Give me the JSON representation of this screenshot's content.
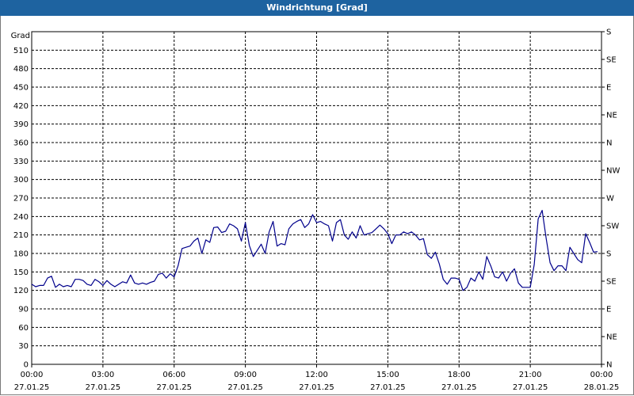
{
  "window": {
    "title": "Windrichtung [Grad]"
  },
  "colors": {
    "titlebar": "#1e63a0",
    "line": "#00008b",
    "grid": "#000000"
  },
  "chart_data": {
    "type": "line",
    "title": "Windrichtung [Grad]",
    "ylabel": "Grad",
    "ylim": [
      0,
      540
    ],
    "yticks": [
      0,
      30,
      60,
      90,
      120,
      150,
      180,
      210,
      240,
      270,
      300,
      330,
      360,
      390,
      420,
      450,
      480,
      510
    ],
    "right_axis_labels": [
      "N",
      "NE",
      "E",
      "SE",
      "S",
      "SW",
      "W",
      "NW",
      "N",
      "NE",
      "E",
      "SE",
      "S"
    ],
    "xlim": [
      "27.01.25 00:00",
      "28.01.25 00:00"
    ],
    "xticks": [
      {
        "time": "00:00",
        "date": "27.01.25"
      },
      {
        "time": "03:00",
        "date": "27.01.25"
      },
      {
        "time": "06:00",
        "date": "27.01.25"
      },
      {
        "time": "09:00",
        "date": "27.01.25"
      },
      {
        "time": "12:00",
        "date": "27.01.25"
      },
      {
        "time": "15:00",
        "date": "27.01.25"
      },
      {
        "time": "18:00",
        "date": "27.01.25"
      },
      {
        "time": "21:00",
        "date": "27.01.25"
      },
      {
        "time": "00:00",
        "date": "28.01.25"
      }
    ],
    "grid": true,
    "series": [
      {
        "x": [
          "00:00",
          "00:10",
          "00:20",
          "00:30",
          "00:40",
          "00:50",
          "01:00",
          "01:10",
          "01:20",
          "01:30",
          "01:40",
          "01:50",
          "02:00",
          "02:10",
          "02:20",
          "02:30",
          "02:40",
          "02:50",
          "03:00",
          "03:10",
          "03:20",
          "03:30",
          "03:40",
          "03:50",
          "04:00",
          "04:10",
          "04:20",
          "04:30",
          "04:40",
          "04:50",
          "05:00",
          "05:10",
          "05:20",
          "05:30",
          "05:40",
          "05:50",
          "06:00",
          "06:10",
          "06:20",
          "06:30",
          "06:40",
          "06:50",
          "07:00",
          "07:10",
          "07:20",
          "07:30",
          "07:40",
          "07:50",
          "08:00",
          "08:10",
          "08:20",
          "08:30",
          "08:40",
          "08:50",
          "09:00",
          "09:10",
          "09:20",
          "09:30",
          "09:40",
          "09:50",
          "10:00",
          "10:10",
          "10:20",
          "10:30",
          "10:40",
          "10:50",
          "11:00",
          "11:10",
          "11:20",
          "11:30",
          "11:40",
          "11:50",
          "12:00",
          "12:10",
          "12:20",
          "12:30",
          "12:40",
          "12:50",
          "13:00",
          "13:10",
          "13:20",
          "13:30",
          "13:40",
          "13:50",
          "14:00",
          "14:10",
          "14:20",
          "14:30",
          "14:40",
          "14:50",
          "15:00",
          "15:10",
          "15:20",
          "15:30",
          "15:40",
          "15:50",
          "16:00",
          "16:10",
          "16:20",
          "16:30",
          "16:40",
          "16:50",
          "17:00",
          "17:10",
          "17:20",
          "17:30",
          "17:40",
          "17:50",
          "18:00",
          "18:10",
          "18:20",
          "18:30",
          "18:40",
          "18:50",
          "19:00",
          "19:10",
          "19:20",
          "19:30",
          "19:40",
          "19:50",
          "20:00",
          "20:10",
          "20:20",
          "20:30",
          "20:40",
          "20:50",
          "21:00",
          "21:10",
          "21:20",
          "21:30",
          "21:40",
          "21:50",
          "22:00",
          "22:10",
          "22:20",
          "22:30",
          "22:40",
          "22:50",
          "23:00",
          "23:10",
          "23:20",
          "23:30",
          "23:40",
          "23:50"
        ],
        "values": [
          130,
          126,
          128,
          128,
          140,
          143,
          125,
          130,
          126,
          128,
          126,
          138,
          138,
          136,
          130,
          128,
          138,
          134,
          128,
          136,
          130,
          126,
          130,
          134,
          132,
          145,
          132,
          130,
          132,
          130,
          133,
          135,
          146,
          148,
          140,
          147,
          142,
          160,
          188,
          190,
          192,
          200,
          205,
          180,
          202,
          198,
          222,
          223,
          214,
          216,
          228,
          225,
          220,
          200,
          230,
          193,
          175,
          185,
          195,
          180,
          215,
          232,
          192,
          196,
          194,
          220,
          228,
          232,
          235,
          222,
          228,
          243,
          230,
          232,
          228,
          225,
          200,
          230,
          235,
          210,
          203,
          215,
          205,
          225,
          210,
          212,
          214,
          220,
          226,
          220,
          212,
          196,
          210,
          210,
          215,
          212,
          215,
          210,
          202,
          204,
          178,
          172,
          182,
          163,
          138,
          130,
          140,
          140,
          138,
          120,
          125,
          140,
          135,
          150,
          138,
          175,
          160,
          142,
          140,
          150,
          135,
          148,
          155,
          132,
          125,
          125,
          125,
          162,
          236,
          250,
          205,
          165,
          152,
          160,
          160,
          152,
          190,
          180,
          170,
          165,
          212,
          198,
          182,
          183
        ]
      }
    ]
  }
}
